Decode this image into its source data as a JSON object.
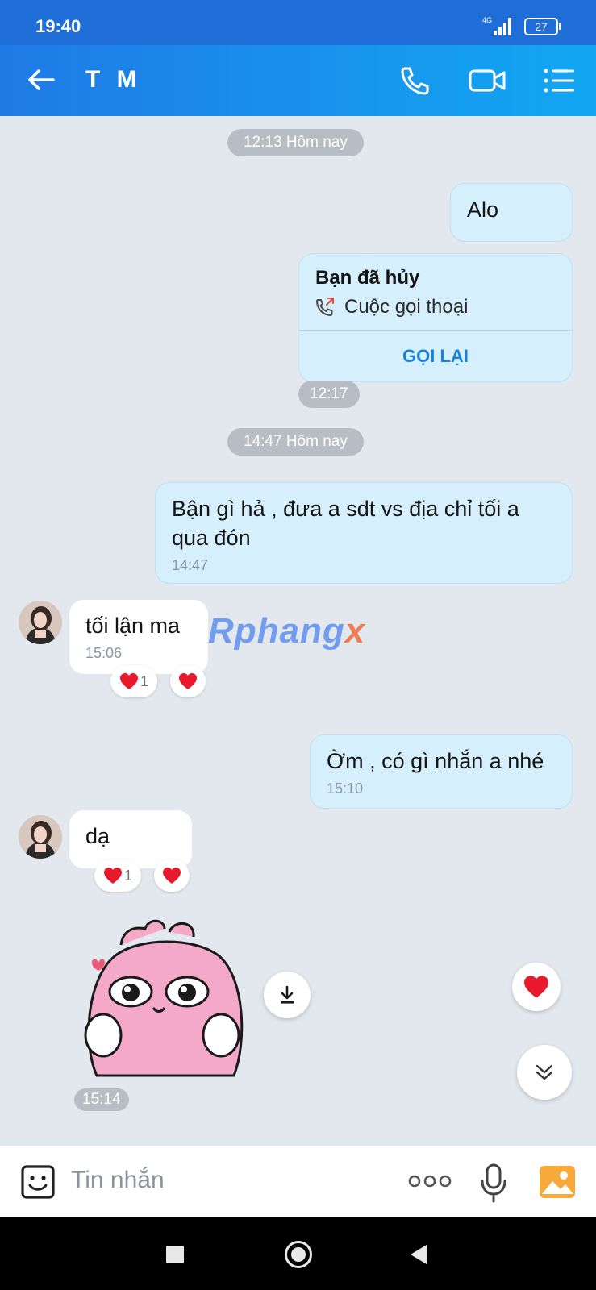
{
  "status_bar": {
    "time": "19:40",
    "network": "4G",
    "battery": "27"
  },
  "header": {
    "title": "T M",
    "icons": [
      "back-arrow-icon",
      "phone-icon",
      "video-call-icon",
      "menu-list-icon"
    ]
  },
  "messages": {
    "pill_1": "12:13 Hôm nay",
    "alo": "Alo",
    "call_card": {
      "title": "Bạn đã hủy",
      "call_type": "Cuộc gọi thoại",
      "callback_label": "GỌI LẠI"
    },
    "time_1217": "12:17",
    "pill_2": "14:47 Hôm nay",
    "msg_busy": {
      "text": "Bận gì hả , đưa a sdt vs địa chỉ tối a qua đón",
      "time": "14:47"
    },
    "msg_toi_lan_ma": {
      "text": "tối lận ma",
      "time": "15:06",
      "reaction_count": "1"
    },
    "msg_om": {
      "text": "Ờm , có gì nhắn a nhé",
      "time": "15:10"
    },
    "msg_da": {
      "text": "dạ",
      "reaction_count": "1"
    },
    "sticker_time": "15:14"
  },
  "watermark": {
    "main": "Rphang",
    "tail": "x"
  },
  "composer": {
    "placeholder": "Tin nhắn"
  },
  "colors": {
    "header_start": "#1f7ae6",
    "header_end": "#12a7f2",
    "outgoing_bubble": "#d6effd",
    "incoming_bubble": "#ffffff",
    "accent": "#1a82d6",
    "heart": "#e8192c"
  }
}
